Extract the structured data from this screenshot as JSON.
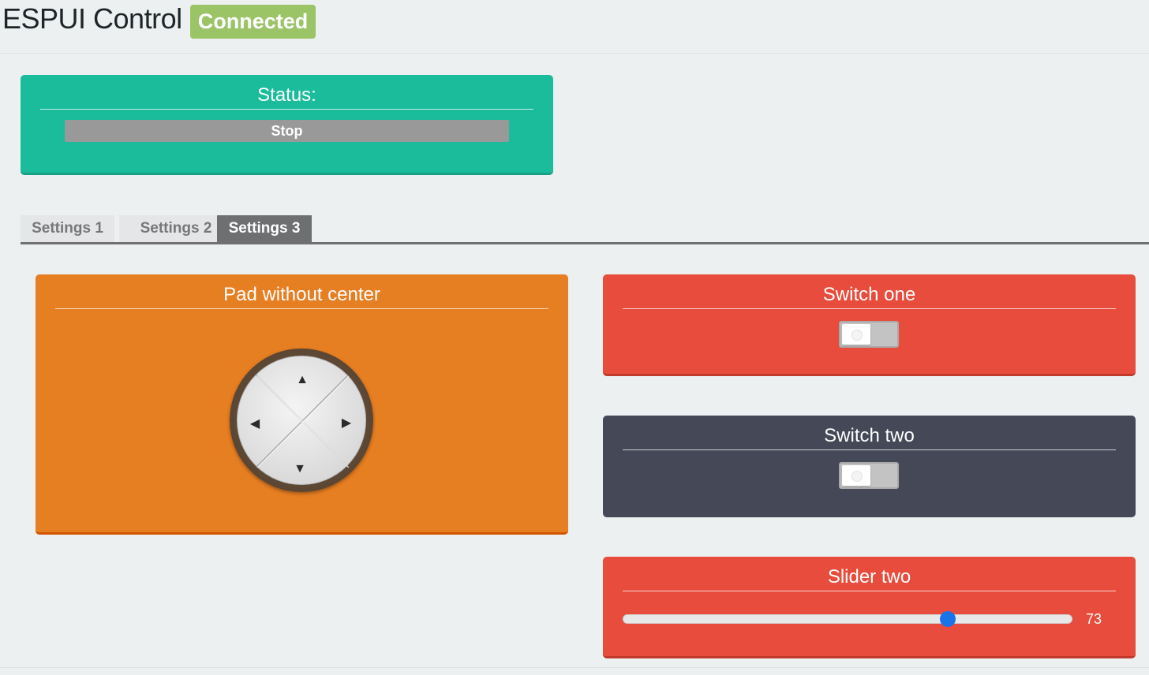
{
  "header": {
    "title": "ESPUI Control",
    "connection_status": "Connected"
  },
  "status_card": {
    "title": "Status:",
    "button_label": "Stop"
  },
  "tabs": [
    {
      "label": "Settings 1",
      "active": false
    },
    {
      "label": "Settings 2",
      "active": false
    },
    {
      "label": "Settings 3",
      "active": true
    }
  ],
  "pad_card": {
    "title": "Pad without center",
    "arrows": {
      "up": "▲",
      "down": "▼",
      "left": "◀",
      "right": "▶"
    }
  },
  "switch_one": {
    "title": "Switch one",
    "on": false
  },
  "switch_two": {
    "title": "Switch two",
    "on": false
  },
  "slider_two": {
    "title": "Slider two",
    "value": "73",
    "min": 0,
    "max": 100
  },
  "colors": {
    "turquoise": "#1abc9c",
    "carrot": "#e67e22",
    "alizarin": "#e74c3c",
    "dark": "#444857",
    "connected": "#9ac466"
  }
}
